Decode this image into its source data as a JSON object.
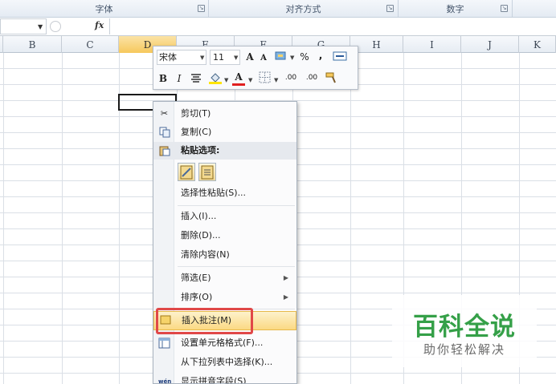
{
  "ribbon": {
    "groups": [
      "字体",
      "对齐方式",
      "数字"
    ]
  },
  "formula_bar": {
    "fx_label": "fx",
    "value": ""
  },
  "columns": [
    "B",
    "C",
    "D",
    "E",
    "F",
    "G",
    "H",
    "I",
    "J",
    "K"
  ],
  "selected_column": "D",
  "mini_toolbar": {
    "font_name": "宋体",
    "font_size": "11",
    "grow_font": "A",
    "shrink_font": "A",
    "percent": "%",
    "comma": ",",
    "bold": "B",
    "italic": "I",
    "font_color": "A",
    "inc_decimal": ".00",
    "dec_decimal": ".00"
  },
  "context_menu": {
    "items": [
      {
        "label": "剪切(T)",
        "icon": "scissors-icon"
      },
      {
        "label": "复制(C)",
        "icon": "copy-icon"
      },
      {
        "label": "粘贴选项:",
        "icon": "paste-icon"
      },
      {
        "label": "选择性粘贴(S)...",
        "icon": ""
      },
      {
        "label": "插入(I)...",
        "icon": ""
      },
      {
        "label": "删除(D)...",
        "icon": ""
      },
      {
        "label": "清除内容(N)",
        "icon": ""
      },
      {
        "label": "筛选(E)",
        "icon": "",
        "submenu": true
      },
      {
        "label": "排序(O)",
        "icon": "",
        "submenu": true
      },
      {
        "label": "插入批注(M)",
        "icon": "comment-icon",
        "highlighted": true
      },
      {
        "label": "设置单元格格式(F)...",
        "icon": "format-cells-icon"
      },
      {
        "label": "从下拉列表中选择(K)...",
        "icon": ""
      },
      {
        "label": "显示拼音字段(S)",
        "icon": "phonetic-icon"
      }
    ]
  },
  "watermark": {
    "title": "百科全说",
    "subtitle": "助你轻松解决"
  }
}
